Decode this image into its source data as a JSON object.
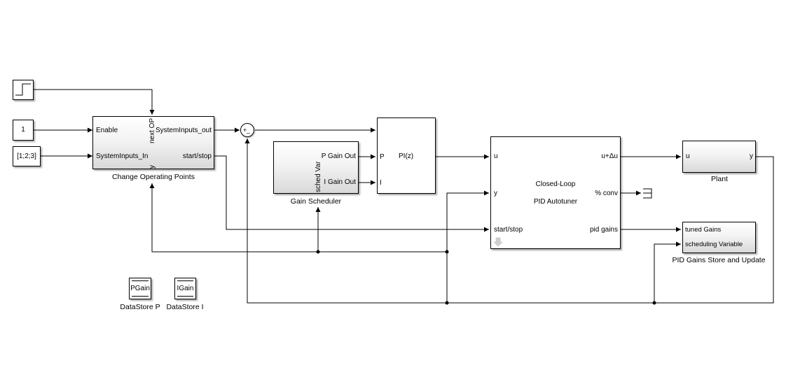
{
  "diagram": {
    "type": "simulink-model",
    "blocks": {
      "step": {
        "name": "Step",
        "icon": "step-icon"
      },
      "const_enable": {
        "value": "1"
      },
      "const_inputs": {
        "value": "[1;2;3]"
      },
      "change_op": {
        "caption": "Change Operating Points",
        "ports": {
          "enable": "Enable",
          "system_inputs_in": "SystemInputs_In",
          "next_op": "next OP",
          "y": "y",
          "system_inputs_out": "SystemInputs_out",
          "start_stop": "start/stop"
        }
      },
      "sum": {
        "signs": "+_"
      },
      "gain_scheduler": {
        "caption": "Gain Scheduler",
        "ports": {
          "p_gain_out": "P Gain Out",
          "i_gain_out": "I Gain Out",
          "sched_var": "sched Var"
        }
      },
      "pi": {
        "label": "PI(z)",
        "ports": {
          "p": "P",
          "i": "I"
        }
      },
      "autotuner": {
        "title_line1": "Closed-Loop",
        "title_line2": "PID Autotuner",
        "ports": {
          "u": "u",
          "y": "y",
          "start_stop": "start/stop",
          "u_delta": "u+Δu",
          "conv": "% conv",
          "pid_gains": "pid gains"
        }
      },
      "plant": {
        "caption": "Plant",
        "ports": {
          "u": "u",
          "y": "y"
        }
      },
      "gains_store": {
        "caption": "PID Gains Store and Update",
        "ports": {
          "tuned_gains": "tuned Gains",
          "scheduling_variable": "scheduling Variable"
        }
      },
      "datastore_p": {
        "label": "PGain",
        "caption": "DataStore P"
      },
      "datastore_i": {
        "label": "IGain",
        "caption": "DataStore I"
      }
    },
    "colors": {
      "line": "#000000",
      "block_border": "#000000",
      "gradient_bottom": "#d9d9d9",
      "background": "#ffffff"
    }
  }
}
